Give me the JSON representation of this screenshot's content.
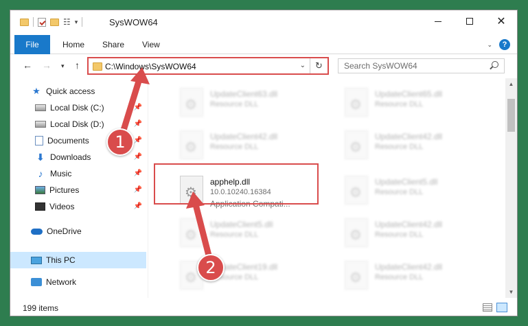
{
  "window": {
    "title": "SysWOW64",
    "controls": [
      "minimize-icon",
      "maximize-icon",
      "close-icon"
    ]
  },
  "ribbon": {
    "tabs": [
      {
        "label": "File",
        "active": true
      },
      {
        "label": "Home"
      },
      {
        "label": "Share"
      },
      {
        "label": "View"
      }
    ],
    "help": "?"
  },
  "address": {
    "path": "C:\\Windows\\SysWOW64",
    "search_placeholder": "Search SysWOW64"
  },
  "nav": {
    "items": [
      {
        "label": "Quick access",
        "icon": "star-icon",
        "pinned": false
      },
      {
        "label": "Local Disk (C:)",
        "icon": "disk-icon",
        "pinned": true
      },
      {
        "label": "Local Disk (D:)",
        "icon": "disk-icon",
        "pinned": true
      },
      {
        "label": "Documents",
        "icon": "documents-icon",
        "pinned": true
      },
      {
        "label": "Downloads",
        "icon": "download-icon",
        "pinned": true
      },
      {
        "label": "Music",
        "icon": "music-icon",
        "pinned": true
      },
      {
        "label": "Pictures",
        "icon": "pictures-icon",
        "pinned": true
      },
      {
        "label": "Videos",
        "icon": "videos-icon",
        "pinned": true
      },
      {
        "label": "OneDrive",
        "icon": "cloud-icon",
        "pinned": false
      },
      {
        "label": "This PC",
        "icon": "pc-icon",
        "pinned": false,
        "selected": true
      },
      {
        "label": "Network",
        "icon": "network-icon",
        "pinned": false
      }
    ]
  },
  "files": [
    {
      "name": "UpdateClient63.dll",
      "type": "Resource DLL"
    },
    {
      "name": "UpdateClient65.dll",
      "type": "Resource DLL"
    },
    {
      "name": "UpdateClient42.dll",
      "type": "Resource DLL"
    },
    {
      "name": "UpdateClient42.dll",
      "type": "Resource DLL"
    },
    {
      "name": "apphelp.dll",
      "version": "10.0.10240.16384",
      "type": "Application Compati..."
    },
    {
      "name": "UpdateClient5.dll",
      "type": "Resource DLL"
    },
    {
      "name": "UpdateClient5.dll",
      "type": "Resource DLL"
    },
    {
      "name": "UpdateClient42.dll",
      "type": "Resource DLL"
    },
    {
      "name": "UpdateClient19.dll",
      "type": "Resource DLL"
    },
    {
      "name": "UpdateClient42.dll",
      "type": "Resource DLL"
    }
  ],
  "status": {
    "item_count": "199 items"
  },
  "annotations": {
    "step1": "1",
    "step2": "2"
  },
  "colors": {
    "accent": "#1979ca",
    "highlight_red": "#d94c4c",
    "selection": "#cce8ff"
  }
}
